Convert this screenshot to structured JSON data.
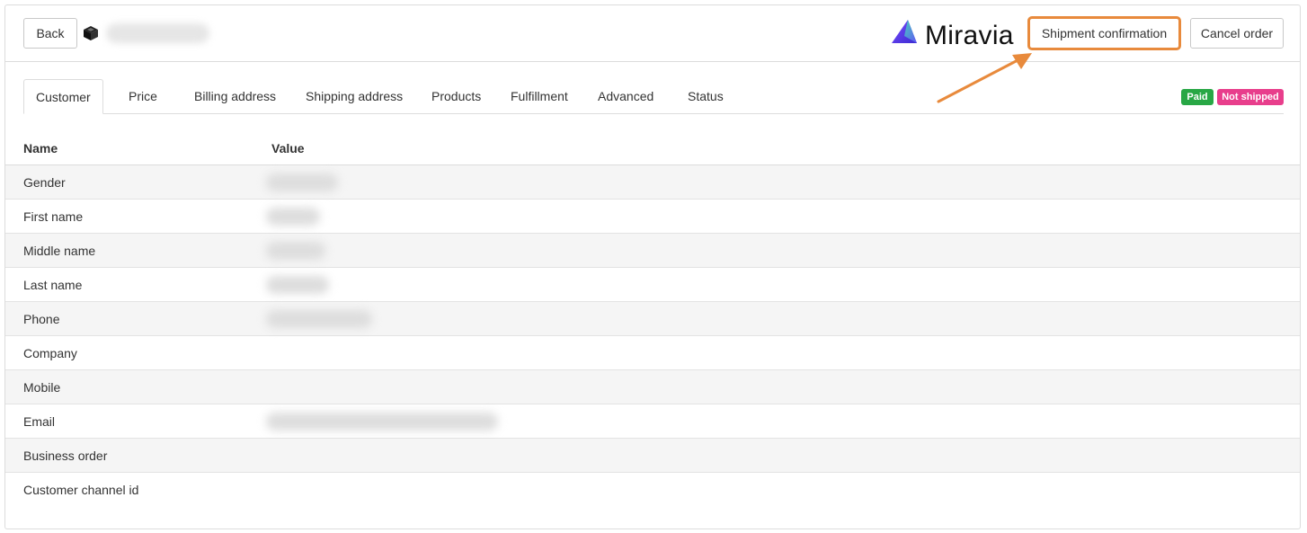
{
  "header": {
    "back_label": "Back",
    "logo_text": "Miravia",
    "shipment_label": "Shipment confirmation",
    "cancel_label": "Cancel order"
  },
  "tabs": [
    {
      "label": "Customer",
      "active": true
    },
    {
      "label": "Price"
    },
    {
      "label": "Billing address"
    },
    {
      "label": "Shipping address"
    },
    {
      "label": "Products"
    },
    {
      "label": "Fulfillment"
    },
    {
      "label": "Advanced"
    },
    {
      "label": "Status"
    }
  ],
  "badges": {
    "paid": "Paid",
    "not_shipped": "Not shipped"
  },
  "table": {
    "headers": {
      "name": "Name",
      "value": "Value"
    },
    "rows": [
      {
        "name": "Gender"
      },
      {
        "name": "First name"
      },
      {
        "name": "Middle name"
      },
      {
        "name": "Last name"
      },
      {
        "name": "Phone"
      },
      {
        "name": "Company"
      },
      {
        "name": "Mobile"
      },
      {
        "name": "Email"
      },
      {
        "name": "Business order"
      },
      {
        "name": "Customer channel id"
      }
    ]
  },
  "colors": {
    "highlight": "#e88a3c",
    "paid": "#28a745",
    "not_shipped": "#e83e8c",
    "logo_purple": "#5b3fd1",
    "logo_green": "#38e0a6"
  }
}
